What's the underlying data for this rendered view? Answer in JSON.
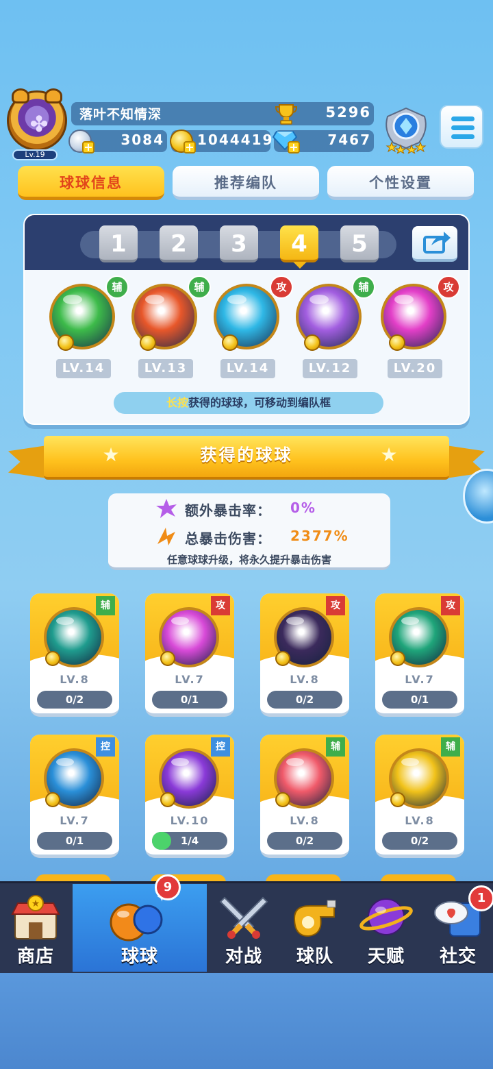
{
  "player": {
    "name": "落叶不知情深",
    "level": "Lv.19",
    "trophies": "5296",
    "silver": "3084",
    "gold": "1044419",
    "gems": "7467"
  },
  "tabs": [
    {
      "label": "球球信息",
      "active": true
    },
    {
      "label": "推荐编队",
      "active": false
    },
    {
      "label": "个性设置",
      "active": false
    }
  ],
  "formation": {
    "slots": [
      "1",
      "2",
      "3",
      "4",
      "5"
    ],
    "active_slot": "4",
    "balls": [
      {
        "tag": "辅",
        "type": "fu",
        "level": "LV.14",
        "color": "#3dbb4a"
      },
      {
        "tag": "辅",
        "type": "fu",
        "level": "LV.13",
        "color": "#e8572a"
      },
      {
        "tag": "攻",
        "type": "gong",
        "level": "LV.14",
        "color": "#2fb8e6"
      },
      {
        "tag": "辅",
        "type": "fu",
        "level": "LV.12",
        "color": "#a25ee0"
      },
      {
        "tag": "攻",
        "type": "gong",
        "level": "LV.20",
        "color": "#e33fc8"
      }
    ],
    "hint_highlight": "长按",
    "hint_rest": "获得的球球，可移动到编队框"
  },
  "section_title": "获得的球球",
  "crit": {
    "extra_rate_label": "额外暴击率：",
    "extra_rate_value": "0%",
    "total_damage_label": "总暴击伤害：",
    "total_damage_value": "2377%",
    "note": "任意球球升级，将永久提升暴击伤害"
  },
  "cards": [
    {
      "tag": "辅",
      "type": "fu",
      "level": "LV.8",
      "progress": "0/2",
      "fill": 0,
      "color": "#1f9c8e"
    },
    {
      "tag": "攻",
      "type": "gong",
      "level": "LV.7",
      "progress": "0/1",
      "fill": 0,
      "color": "#d84ad8"
    },
    {
      "tag": "攻",
      "type": "gong",
      "level": "LV.8",
      "progress": "0/2",
      "fill": 0,
      "color": "#3b2a5c"
    },
    {
      "tag": "攻",
      "type": "gong",
      "level": "LV.7",
      "progress": "0/1",
      "fill": 0,
      "color": "#1fa57a"
    },
    {
      "tag": "控",
      "type": "kong",
      "level": "LV.7",
      "progress": "0/1",
      "fill": 0,
      "color": "#2a8fd8"
    },
    {
      "tag": "控",
      "type": "kong",
      "level": "LV.10",
      "progress": "1/4",
      "fill": 0.25,
      "color": "#8a3ad8"
    },
    {
      "tag": "辅",
      "type": "fu",
      "level": "LV.8",
      "progress": "0/2",
      "fill": 0,
      "color": "#f05a6a"
    },
    {
      "tag": "辅",
      "type": "fu",
      "level": "LV.8",
      "progress": "0/2",
      "fill": 0,
      "color": "#f1c21a"
    }
  ],
  "nav": {
    "items": [
      {
        "label": "商店",
        "icon": "shop-icon"
      },
      {
        "label": "球球",
        "icon": "balls-icon",
        "active": true,
        "badge": "9"
      },
      {
        "label": "对战",
        "icon": "swords-icon"
      },
      {
        "label": "球队",
        "icon": "whistle-icon"
      },
      {
        "label": "天赋",
        "icon": "planet-icon"
      },
      {
        "label": "社交",
        "icon": "chat-icon",
        "badge": "1"
      }
    ]
  }
}
